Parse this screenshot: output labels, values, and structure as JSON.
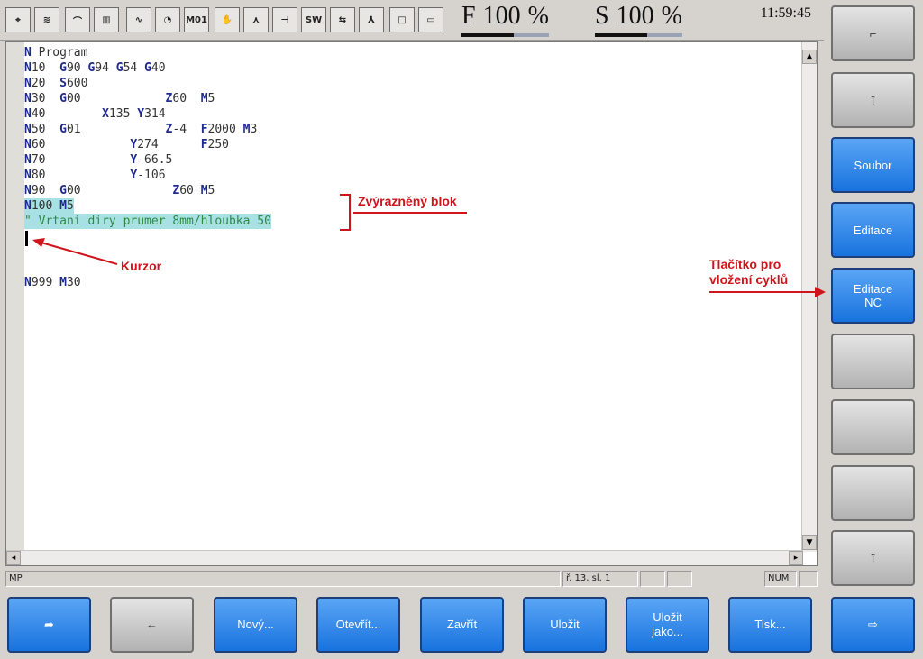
{
  "toolbar": {
    "tools": [
      {
        "icon": "reference-icon",
        "glyph": "⌖"
      },
      {
        "icon": "zigzag-icon",
        "glyph": "≋"
      },
      {
        "icon": "arc-icon",
        "glyph": "⌒"
      },
      {
        "icon": "tool-holder-icon",
        "glyph": "▥"
      },
      {
        "icon": "wave-icon",
        "glyph": "∿"
      },
      {
        "icon": "gauge-icon",
        "glyph": "◔"
      },
      {
        "icon": "m01-icon",
        "glyph": "M01"
      },
      {
        "icon": "hand-icon",
        "glyph": "✋"
      },
      {
        "icon": "angle-icon",
        "glyph": "⋏"
      },
      {
        "icon": "line-icon",
        "glyph": "⊣"
      },
      {
        "icon": "switch-icon",
        "glyph": "SW"
      },
      {
        "icon": "arrows-icon",
        "glyph": "⇆"
      },
      {
        "icon": "branch-icon",
        "glyph": "⅄"
      },
      {
        "icon": "square-small-icon",
        "glyph": "□"
      },
      {
        "icon": "square-icon",
        "glyph": "▭"
      }
    ],
    "feed": {
      "letter": "F",
      "value": "100",
      "unit": "%",
      "bar_fraction": 0.6
    },
    "spindle": {
      "letter": "S",
      "value": "100",
      "unit": "%",
      "bar_fraction": 0.6
    },
    "clock": "11:59:45"
  },
  "editor": {
    "lines": [
      [
        {
          "t": "N",
          "c": "nw"
        },
        {
          "t": " Program"
        }
      ],
      [
        {
          "t": "N",
          "c": "nw"
        },
        {
          "t": "10  "
        },
        {
          "t": "G",
          "c": "nw"
        },
        {
          "t": "90 "
        },
        {
          "t": "G",
          "c": "nw"
        },
        {
          "t": "94 "
        },
        {
          "t": "G",
          "c": "nw"
        },
        {
          "t": "54 "
        },
        {
          "t": "G",
          "c": "nw"
        },
        {
          "t": "40"
        }
      ],
      [
        {
          "t": "N",
          "c": "nw"
        },
        {
          "t": "20  "
        },
        {
          "t": "S",
          "c": "nw"
        },
        {
          "t": "600"
        }
      ],
      [
        {
          "t": "N",
          "c": "nw"
        },
        {
          "t": "30  "
        },
        {
          "t": "G",
          "c": "nw"
        },
        {
          "t": "00            "
        },
        {
          "t": "Z",
          "c": "nw"
        },
        {
          "t": "60  "
        },
        {
          "t": "M",
          "c": "nw"
        },
        {
          "t": "5"
        }
      ],
      [
        {
          "t": "N",
          "c": "nw"
        },
        {
          "t": "40        "
        },
        {
          "t": "X",
          "c": "nw"
        },
        {
          "t": "135 "
        },
        {
          "t": "Y",
          "c": "nw"
        },
        {
          "t": "314"
        }
      ],
      [
        {
          "t": "N",
          "c": "nw"
        },
        {
          "t": "50  "
        },
        {
          "t": "G",
          "c": "nw"
        },
        {
          "t": "01            "
        },
        {
          "t": "Z",
          "c": "nw"
        },
        {
          "t": "-4  "
        },
        {
          "t": "F",
          "c": "nw"
        },
        {
          "t": "2000 "
        },
        {
          "t": "M",
          "c": "nw"
        },
        {
          "t": "3"
        }
      ],
      [
        {
          "t": "N",
          "c": "nw"
        },
        {
          "t": "60            "
        },
        {
          "t": "Y",
          "c": "nw"
        },
        {
          "t": "274      "
        },
        {
          "t": "F",
          "c": "nw"
        },
        {
          "t": "250"
        }
      ],
      [
        {
          "t": "N",
          "c": "nw"
        },
        {
          "t": "70            "
        },
        {
          "t": "Y",
          "c": "nw"
        },
        {
          "t": "-66.5"
        }
      ],
      [
        {
          "t": "N",
          "c": "nw"
        },
        {
          "t": "80            "
        },
        {
          "t": "Y",
          "c": "nw"
        },
        {
          "t": "-106"
        }
      ],
      [
        {
          "t": "N",
          "c": "nw"
        },
        {
          "t": "90  "
        },
        {
          "t": "G",
          "c": "nw"
        },
        {
          "t": "00             "
        },
        {
          "t": "Z",
          "c": "nw"
        },
        {
          "t": "60 "
        },
        {
          "t": "M",
          "c": "nw"
        },
        {
          "t": "5"
        }
      ],
      [
        {
          "t": "N",
          "c": "nw"
        },
        {
          "t": "100 "
        },
        {
          "t": "M",
          "c": "nw"
        },
        {
          "t": "5"
        }
      ],
      [
        {
          "t": "\" Vrtani diry prumer 8mm/hloubka 50",
          "c": "cmt"
        }
      ],
      [],
      [],
      [],
      [
        {
          "t": "N",
          "c": "nw"
        },
        {
          "t": "999 "
        },
        {
          "t": "M",
          "c": "nw"
        },
        {
          "t": "30"
        }
      ]
    ],
    "highlight_lines": [
      10,
      11
    ]
  },
  "annotations": {
    "block": "Zvýrazněný blok",
    "cursor": "Kurzor",
    "cycle_button": "Tlačítko pro vložení cyklů"
  },
  "status": {
    "mode": "MP",
    "position": "ř. 13,  sl. 1",
    "num": "NUM"
  },
  "side_buttons": [
    {
      "label": "⌐",
      "style": "gray",
      "icon": "return-icon"
    },
    {
      "label": "î",
      "style": "gray",
      "icon": "up-icon"
    },
    {
      "label": "Soubor",
      "style": "blue"
    },
    {
      "label": "Editace",
      "style": "blue"
    },
    {
      "label": "Editace\nNC",
      "style": "blue"
    },
    {
      "label": "",
      "style": "gray"
    },
    {
      "label": "",
      "style": "gray"
    },
    {
      "label": "",
      "style": "gray"
    },
    {
      "label": "ï",
      "style": "gray",
      "icon": "down-icon"
    }
  ],
  "bottom_buttons": [
    {
      "label": "➦",
      "style": "blue",
      "icon": "back-arrow-icon"
    },
    {
      "label": "←",
      "style": "gray",
      "icon": "left-arrow-icon"
    },
    {
      "label": "Nový...",
      "style": "blue"
    },
    {
      "label": "Otevřít...",
      "style": "blue"
    },
    {
      "label": "Zavřít",
      "style": "blue"
    },
    {
      "label": "Uložit",
      "style": "blue"
    },
    {
      "label": "Uložit\njako...",
      "style": "blue"
    },
    {
      "label": "Tisk...",
      "style": "blue"
    },
    {
      "label": "⇨",
      "style": "blue",
      "icon": "forward-arrow-icon"
    }
  ]
}
